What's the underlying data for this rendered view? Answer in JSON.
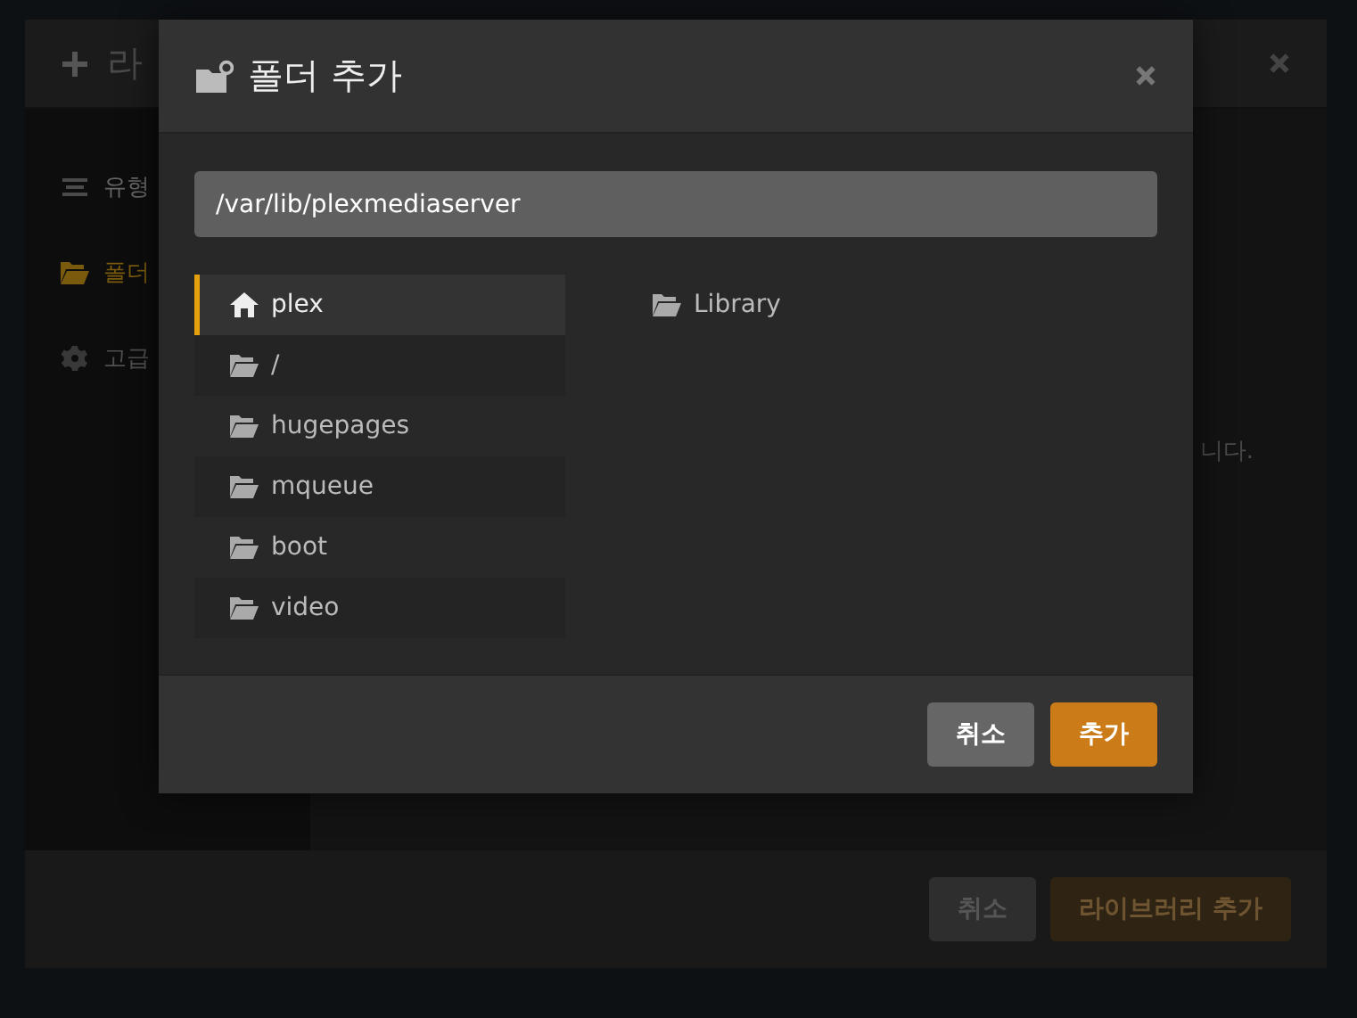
{
  "background_dialog": {
    "title": "라",
    "sidebar": {
      "items": [
        {
          "label": "유형",
          "kind": "list",
          "selected": false,
          "disabled": false
        },
        {
          "label": "폴더",
          "kind": "folder",
          "selected": true,
          "disabled": false
        },
        {
          "label": "고급",
          "kind": "gear",
          "selected": false,
          "disabled": true
        }
      ]
    },
    "content_text": "니다.",
    "buttons": [
      {
        "label": "취소",
        "kind": "secondary"
      },
      {
        "label": "라이브러리 추가",
        "kind": "primary"
      }
    ]
  },
  "dialog": {
    "title": "폴더 추가",
    "path": "/var/lib/plexmediaserver",
    "locations": [
      {
        "label": "plex",
        "kind": "home",
        "selected": true
      },
      {
        "label": "/",
        "kind": "folder",
        "selected": false
      },
      {
        "label": "hugepages",
        "kind": "folder",
        "selected": false
      },
      {
        "label": "mqueue",
        "kind": "folder",
        "selected": false
      },
      {
        "label": "boot",
        "kind": "folder",
        "selected": false
      },
      {
        "label": "video",
        "kind": "folder",
        "selected": false
      }
    ],
    "folders": [
      {
        "label": "Library"
      }
    ],
    "buttons": [
      {
        "label": "취소",
        "kind": "secondary"
      },
      {
        "label": "추가",
        "kind": "primary"
      }
    ]
  }
}
